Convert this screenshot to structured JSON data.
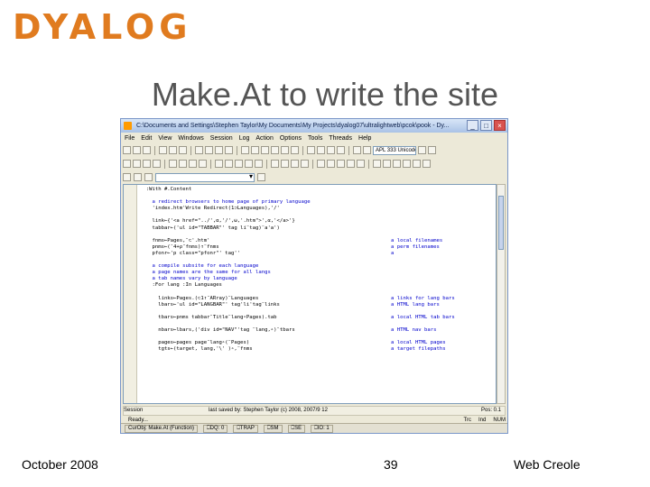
{
  "logo": {
    "text": "DYALOG",
    "color": "#e07b1f"
  },
  "slide": {
    "title": "Make.At to write the site"
  },
  "footer": {
    "date": "October 2008",
    "page": "39",
    "topic": "Web Creole"
  },
  "window": {
    "title": "C:\\Documents and Settings\\Stephen Taylor\\My Documents\\My Projects\\dyalog07\\ultralightweb\\pcok\\pook - Dy...",
    "menu": [
      "File",
      "Edit",
      "View",
      "Windows",
      "Session",
      "Log",
      "Action",
      "Options",
      "Tools",
      "Threads",
      "Help"
    ],
    "toolbar_combo": "APL 333 Unicode",
    "code": [
      {
        "text": "  :With #.Content",
        "comment": ""
      },
      {
        "text": "",
        "comment": ""
      },
      {
        "text": "    a redirect browsers to home page of primary language",
        "comment": "",
        "is_comment": true
      },
      {
        "text": "    'index.htm'Write Redirect(1⊃Languages),'/'",
        "comment": ""
      },
      {
        "text": "",
        "comment": ""
      },
      {
        "text": "    link←{'<a href=\"../',⍺,'/',⍵,'.htm\">',⍺,'</a>'}",
        "comment": ""
      },
      {
        "text": "    tabbar←('ul id=\"TABBAR\"' tag li¨tag)¨a'a')",
        "comment": ""
      },
      {
        "text": "",
        "comment": ""
      },
      {
        "text": "    fnms←Pages,¨⊂'.htm'",
        "comment": "a local filenames"
      },
      {
        "text": "    pnms←(¯4+⍴¨fnms)↑¨fnms",
        "comment": "a perm filenames"
      },
      {
        "text": "    pfonr←'p class=\"pfonr\"' tag''",
        "comment": "a"
      },
      {
        "text": "",
        "comment": ""
      },
      {
        "text": "    a compile subsite for each language",
        "comment": "",
        "is_comment": true
      },
      {
        "text": "    a page names are the same for all langs",
        "comment": "",
        "is_comment": true
      },
      {
        "text": "    a tab names vary by language",
        "comment": "",
        "is_comment": true
      },
      {
        "text": "    :For lang :In Languages",
        "comment": ""
      },
      {
        "text": "",
        "comment": ""
      },
      {
        "text": "      links←Pages.(⊂1↑¨ARray)¨Languages",
        "comment": "a links for lang bars"
      },
      {
        "text": "      lbars←'ul id=\"LANGBAR\"' tag'li'tag¨links",
        "comment": "a HTML lang bars"
      },
      {
        "text": "",
        "comment": ""
      },
      {
        "text": "      tbars←pnms tabbar¨Title¨lang∘Pages).tab",
        "comment": "a local HTML tab bars"
      },
      {
        "text": "",
        "comment": ""
      },
      {
        "text": "      nbars←lbars,('div id=\"NAV\"'tag ¨lang,∘)¨tbars",
        "comment": "a HTML nav bars"
      },
      {
        "text": "",
        "comment": ""
      },
      {
        "text": "      pages←pages page¨lang∘(¨Pages)",
        "comment": "a local HTML pages"
      },
      {
        "text": "      tgts←(target, lang,'\\' )∘,¨fnms",
        "comment": "a target filepaths"
      }
    ],
    "bottom_left": "Session",
    "bottom_mid": "last saved by: Stephen Taylor (c) 2008, 2007/9 12",
    "bottom_right": "Pos: 0.1",
    "status": [
      "Ready...",
      "Trc",
      "Ind",
      "NUM"
    ],
    "taskbar": [
      "CurObj: Make.At (Function)",
      "⎕DQ: 0",
      "⎕TRAP",
      "⎕SM",
      "⎕SE",
      "⎕IO: 1"
    ]
  }
}
